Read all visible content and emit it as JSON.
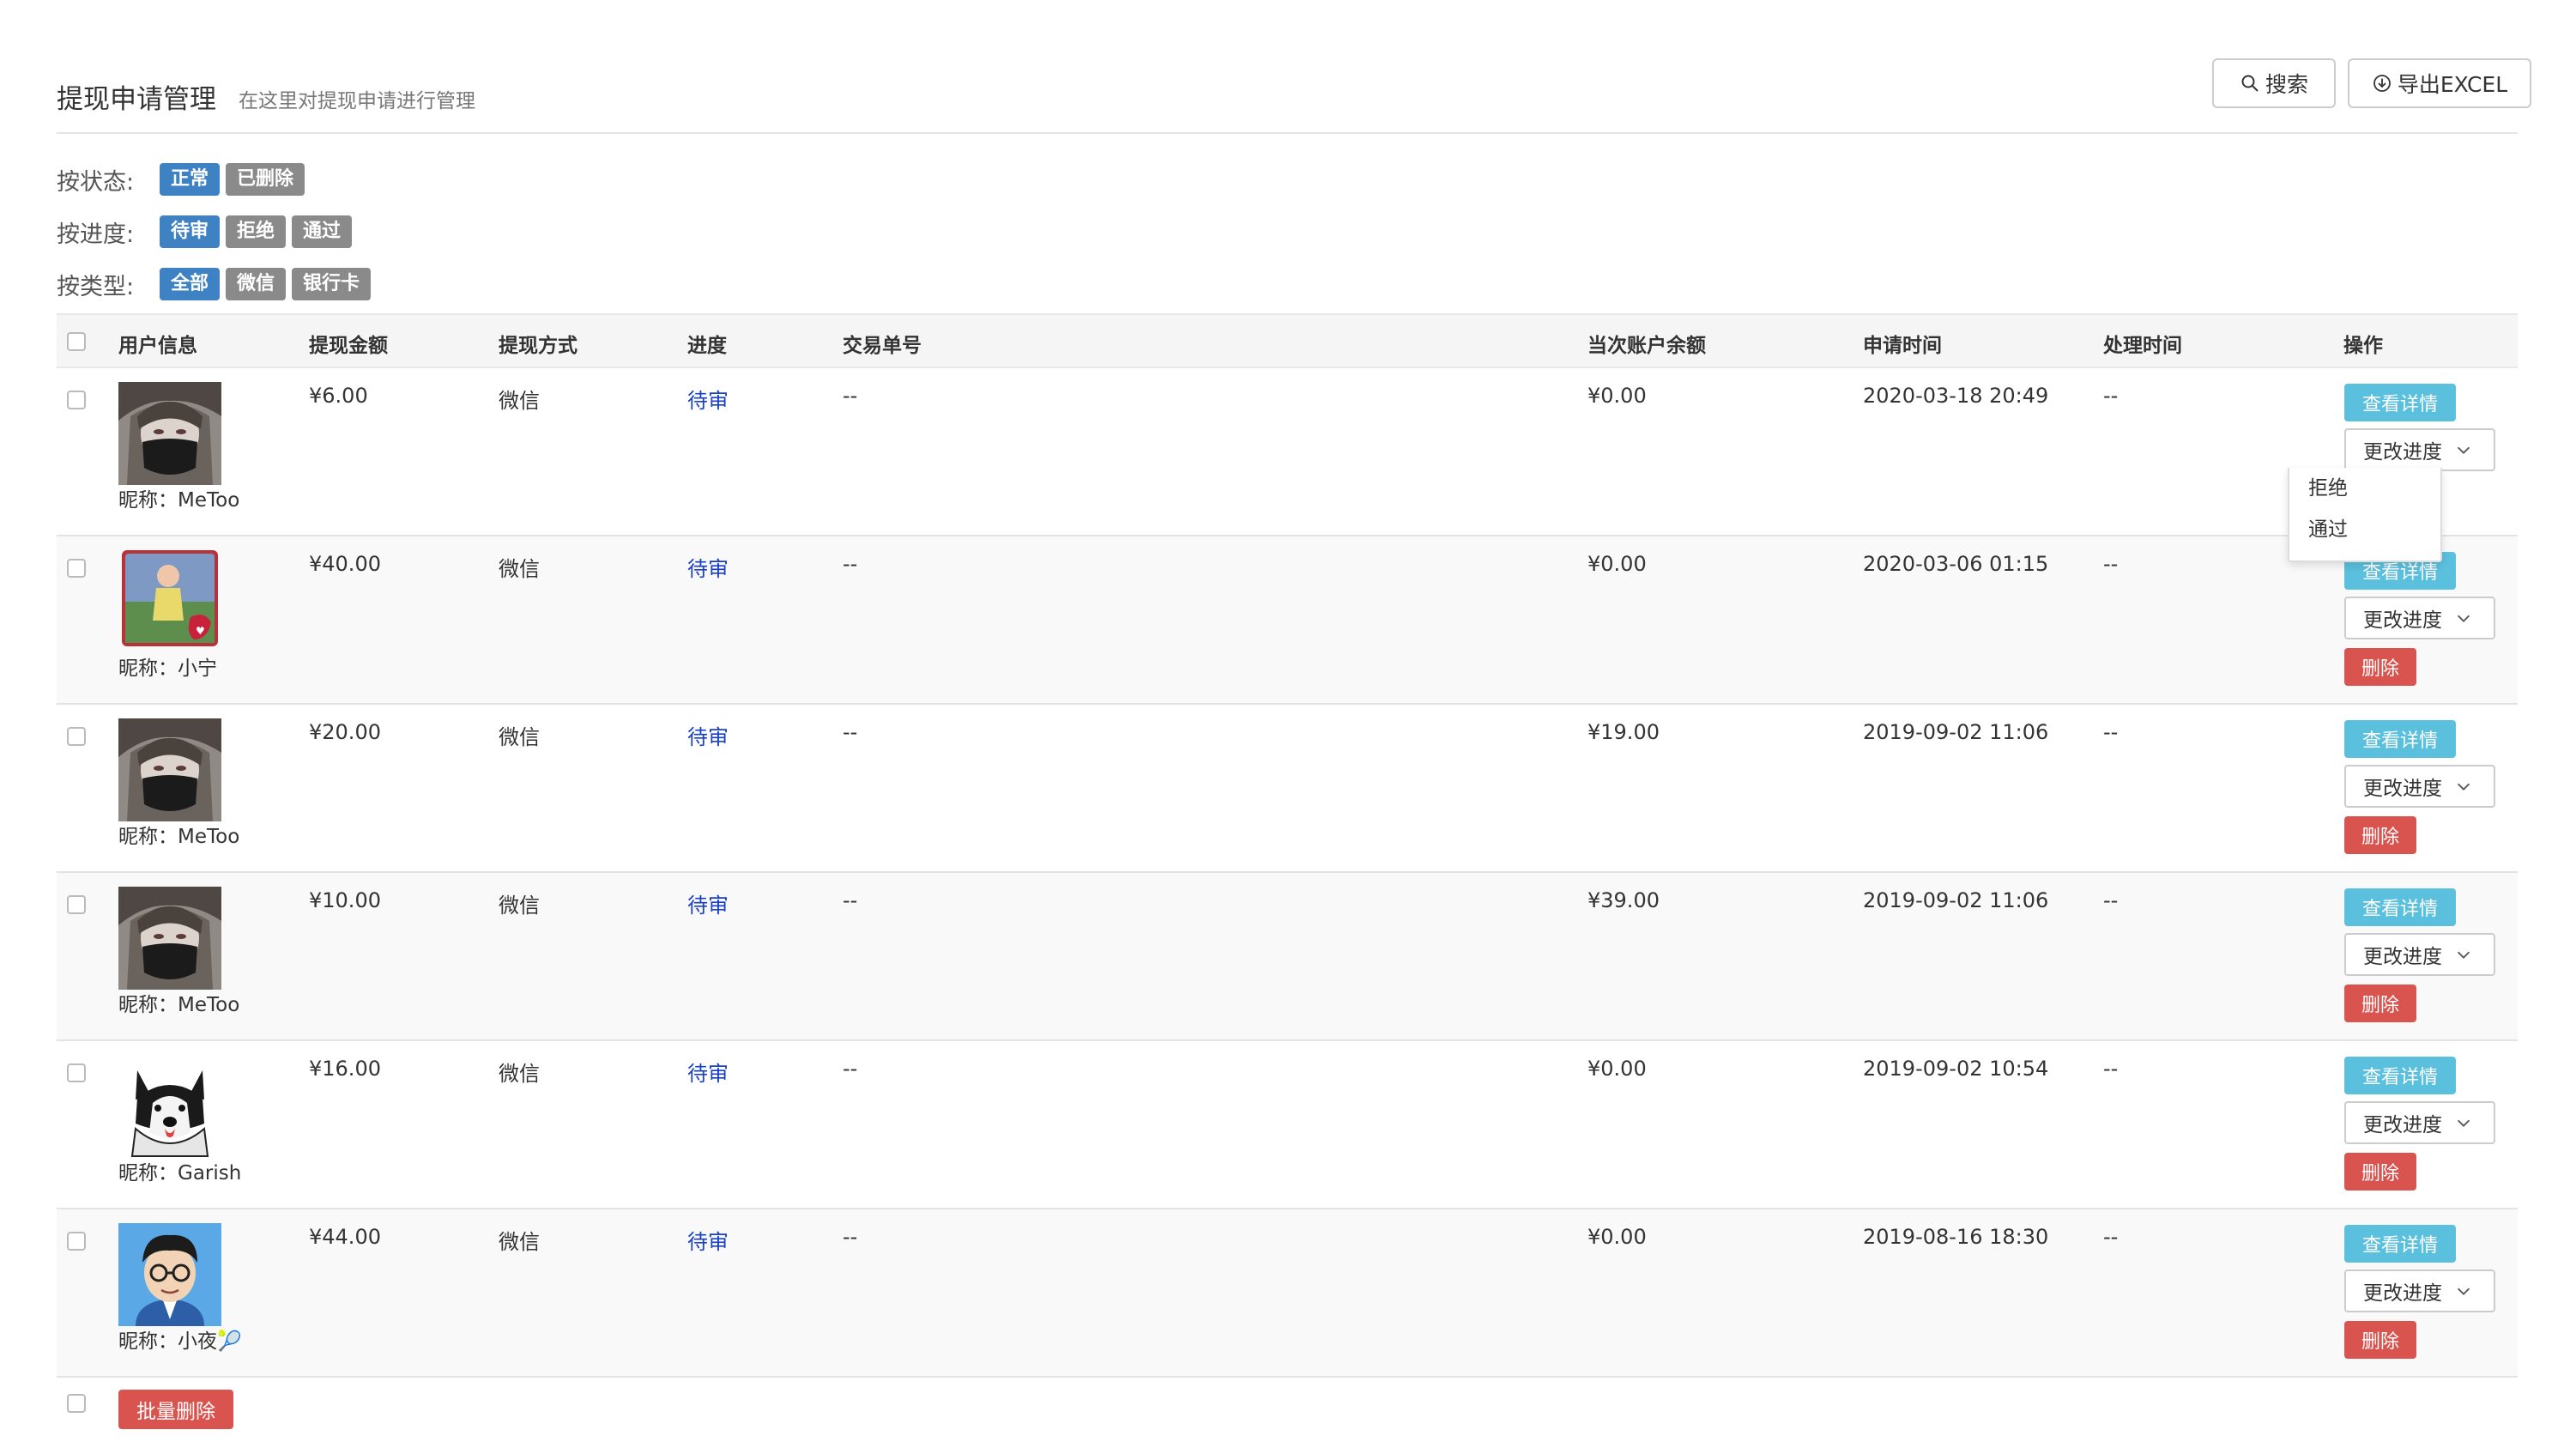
{
  "header": {
    "title": "提现申请管理",
    "subtitle": "在这里对提现申请进行管理",
    "search_label": "搜索",
    "export_label": "导出EXCEL"
  },
  "filters": [
    {
      "label": "按状态:",
      "options": [
        "正常",
        "已删除"
      ],
      "active": 0
    },
    {
      "label": "按进度:",
      "options": [
        "待审",
        "拒绝",
        "通过"
      ],
      "active": 0
    },
    {
      "label": "按类型:",
      "options": [
        "全部",
        "微信",
        "银行卡"
      ],
      "active": 0
    }
  ],
  "table": {
    "headers": {
      "user": "用户信息",
      "amount": "提现金额",
      "method": "提现方式",
      "progress": "进度",
      "trade_no": "交易单号",
      "balance": "当次账户余额",
      "apply_time": "申请时间",
      "process_time": "处理时间",
      "actions": "操作"
    },
    "rows": [
      {
        "nickname": "昵称：MeToo",
        "avatar": "girl-mask-avatar",
        "amount": "¥6.00",
        "method": "微信",
        "progress": "待审",
        "trade_no": "--",
        "balance": "¥0.00",
        "apply_time": "2020-03-18 20:49",
        "process_time": "--"
      },
      {
        "nickname": "昵称：小宁",
        "avatar": "child-photo-avatar",
        "amount": "¥40.00",
        "method": "微信",
        "progress": "待审",
        "trade_no": "--",
        "balance": "¥0.00",
        "apply_time": "2020-03-06 01:15",
        "process_time": "--"
      },
      {
        "nickname": "昵称：MeToo",
        "avatar": "girl-mask-avatar",
        "amount": "¥20.00",
        "method": "微信",
        "progress": "待审",
        "trade_no": "--",
        "balance": "¥19.00",
        "apply_time": "2019-09-02 11:06",
        "process_time": "--"
      },
      {
        "nickname": "昵称：MeToo",
        "avatar": "girl-mask-avatar",
        "amount": "¥10.00",
        "method": "微信",
        "progress": "待审",
        "trade_no": "--",
        "balance": "¥39.00",
        "apply_time": "2019-09-02 11:06",
        "process_time": "--"
      },
      {
        "nickname": "昵称：Garish",
        "avatar": "husky-dog-avatar",
        "amount": "¥16.00",
        "method": "微信",
        "progress": "待审",
        "trade_no": "--",
        "balance": "¥0.00",
        "apply_time": "2019-09-02 10:54",
        "process_time": "--"
      },
      {
        "nickname": "昵称：小夜🎾",
        "avatar": "cartoon-boy-avatar",
        "amount": "¥44.00",
        "method": "微信",
        "progress": "待审",
        "trade_no": "--",
        "balance": "¥0.00",
        "apply_time": "2019-08-16 18:30",
        "process_time": "--"
      }
    ],
    "actions": {
      "detail": "查看详情",
      "change_progress": "更改进度",
      "delete": "删除"
    }
  },
  "dropdown": {
    "items": [
      "拒绝",
      "通过"
    ]
  },
  "footer": {
    "batch_delete": "批量删除"
  },
  "colors": {
    "primary_tag": "#3f82c4",
    "inactive_tag": "#8a8a8a",
    "info_button": "#5bc0de",
    "danger_button": "#d9534f",
    "progress_link": "#1a40c8"
  }
}
